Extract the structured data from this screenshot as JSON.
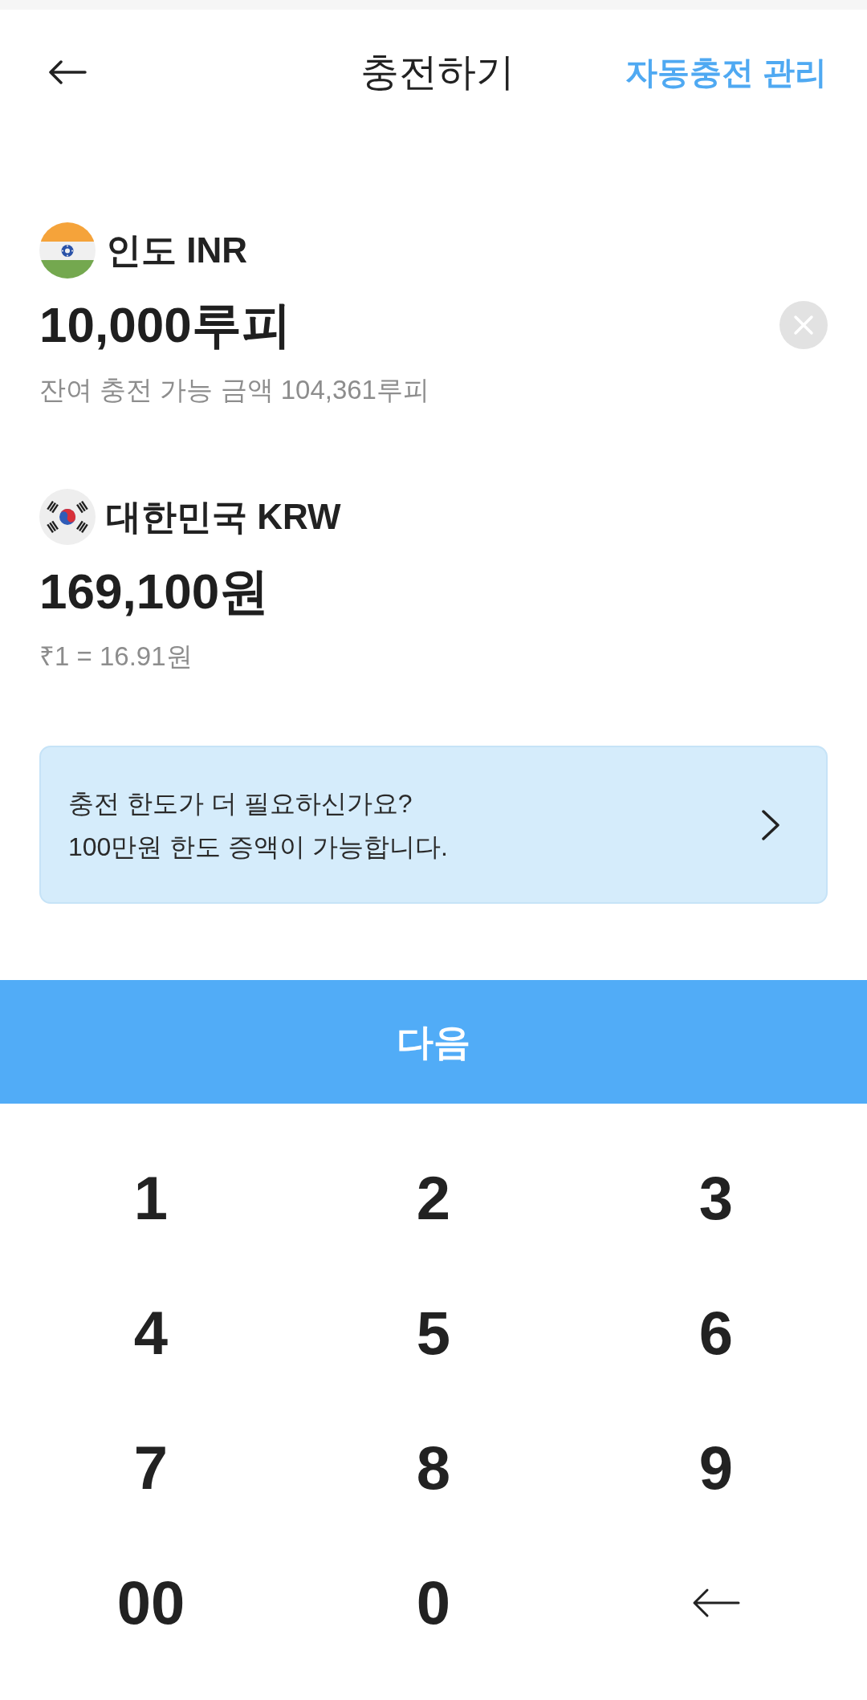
{
  "header": {
    "title": "충전하기",
    "action": "자동충전 관리"
  },
  "pay": {
    "currency": "인도 INR",
    "amount": "10,000루피",
    "note": "잔여 충전 가능 금액 104,361루피"
  },
  "receive": {
    "currency": "대한민국 KRW",
    "amount": "169,100원",
    "note": "₹1 = 16.91원"
  },
  "banner": {
    "lines": [
      "충전 한도가 더 필요하신가요?",
      "100만원 한도 증액이 가능합니다."
    ]
  },
  "next_button": {
    "label": "다음"
  },
  "keypad": [
    {
      "kind": "digit",
      "label": "1"
    },
    {
      "kind": "digit",
      "label": "2"
    },
    {
      "kind": "digit",
      "label": "3"
    },
    {
      "kind": "digit",
      "label": "4"
    },
    {
      "kind": "digit",
      "label": "5"
    },
    {
      "kind": "digit",
      "label": "6"
    },
    {
      "kind": "digit",
      "label": "7"
    },
    {
      "kind": "digit",
      "label": "8"
    },
    {
      "kind": "digit",
      "label": "9"
    },
    {
      "kind": "digit",
      "label": "00"
    },
    {
      "kind": "digit",
      "label": "0"
    },
    {
      "kind": "backspace"
    }
  ]
}
